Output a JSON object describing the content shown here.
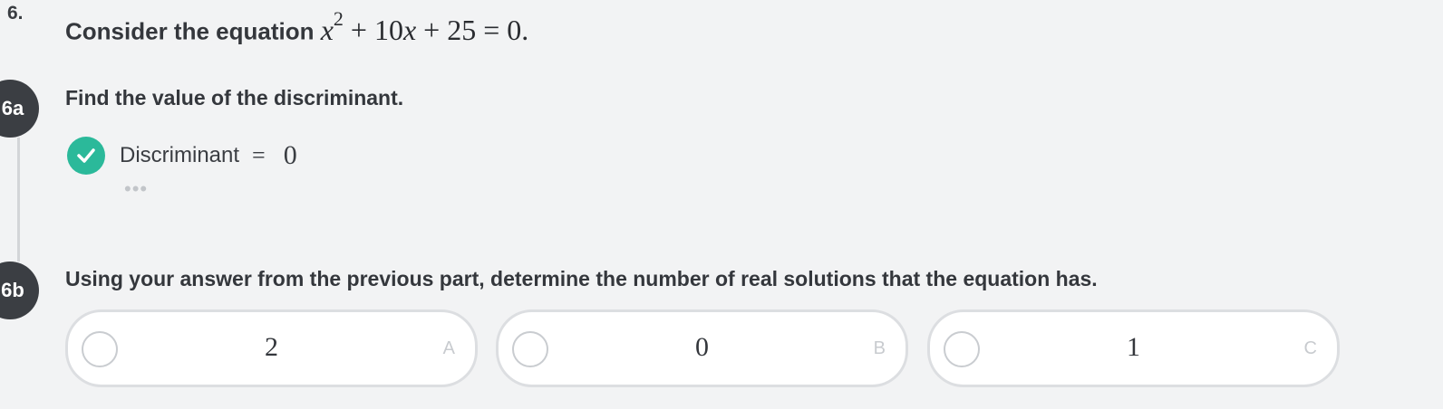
{
  "question": {
    "number": "6.",
    "stem_text": "Consider the equation",
    "equation": {
      "var": "x",
      "exponent": "2",
      "rest": "+ 10",
      "var2": "x",
      "tail": "+ 25 = 0."
    }
  },
  "part_a": {
    "badge": "6a",
    "prompt": "Find the value of the discriminant.",
    "answer_label": "Discriminant",
    "answer_equals": "=",
    "answer_value": "0",
    "status": "correct",
    "more": "•••",
    "colors": {
      "check": "#2bb99a"
    }
  },
  "part_b": {
    "badge": "6b",
    "prompt": "Using your answer from the previous part, determine the number of real solutions that the equation has.",
    "choices": [
      {
        "value": "2",
        "letter": "A"
      },
      {
        "value": "0",
        "letter": "B"
      },
      {
        "value": "1",
        "letter": "C"
      }
    ]
  },
  "icons": {
    "check": "check-icon",
    "radio": "radio-unselected"
  }
}
